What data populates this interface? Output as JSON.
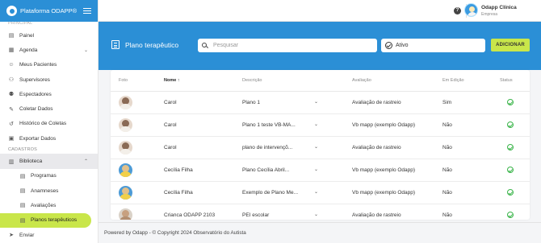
{
  "brand": {
    "title": "Plataforma ODAPP®"
  },
  "sidebar": {
    "top_label": "PRINCIPAL",
    "items": [
      {
        "label": "Painel",
        "icon": "dashboard-icon"
      },
      {
        "label": "Agenda",
        "icon": "calendar-icon"
      },
      {
        "label": "Meus Pacientes",
        "icon": "users-icon"
      },
      {
        "label": "Supervisores",
        "icon": "supervisor-icon"
      },
      {
        "label": "Espectadores",
        "icon": "viewers-icon"
      },
      {
        "label": "Coletar Dados",
        "icon": "pencil-icon"
      },
      {
        "label": "Histórico de Coletas",
        "icon": "history-icon"
      },
      {
        "label": "Exportar Dados",
        "icon": "export-icon"
      }
    ],
    "section_cadastros": "CADASTROS",
    "library": {
      "label": "Biblioteca",
      "icon": "library-icon"
    },
    "library_items": [
      {
        "label": "Programas"
      },
      {
        "label": "Anamneses"
      },
      {
        "label": "Avaliações"
      },
      {
        "label": "Planos terapêuticos"
      }
    ],
    "send": {
      "label": "Enviar"
    }
  },
  "topbar": {
    "help": "?",
    "user_name": "Odapp Clínica",
    "user_role": "Empresa"
  },
  "header": {
    "page_title": "Plano terapêutico",
    "search_placeholder": "Pesquisar",
    "status_value": "Ativo",
    "add_button": "ADICIONAR"
  },
  "table": {
    "columns": [
      "Foto",
      "Nome ↑",
      "Descrição",
      "Avaliação",
      "Em Edição",
      "Status"
    ],
    "rows": [
      {
        "name": "Carol",
        "description": "Plano 1",
        "evaluation": "Avaliação de rastreio",
        "editing": "Sim",
        "photo": "t1"
      },
      {
        "name": "Carol",
        "description": "Plano 1 teste VB-MA...",
        "evaluation": "Vb mapp (exemplo Odapp)",
        "editing": "Não",
        "photo": "t1"
      },
      {
        "name": "Carol",
        "description": "plano de intervençõ...",
        "evaluation": "Avaliação de rastreio",
        "editing": "Não",
        "photo": "t1"
      },
      {
        "name": "Cecília Filha",
        "description": "Plano Cecília Abril...",
        "evaluation": "Vb mapp (exemplo Odapp)",
        "editing": "Não",
        "photo": "t2"
      },
      {
        "name": "Cecília Filha",
        "description": "Exemplo de Plano Me...",
        "evaluation": "Vb mapp (exemplo Odapp)",
        "editing": "Não",
        "photo": "t2"
      },
      {
        "name": "Crianca ODAPP 2103",
        "description": "PEI escolar",
        "evaluation": "Avaliação de rastreio",
        "editing": "Não",
        "photo": "t3"
      }
    ]
  },
  "footer": {
    "text": "Powered by Odapp - © Copyright 2024 Observatório do Autista"
  },
  "colors": {
    "primary": "#2b8fd6",
    "accent": "#c9e64a",
    "success": "#3bb54a"
  }
}
